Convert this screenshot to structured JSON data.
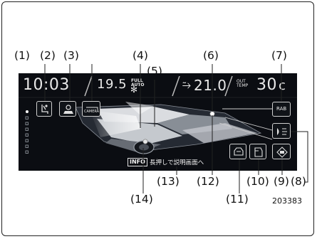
{
  "callouts": {
    "c1": "(1)",
    "c2": "(2)",
    "c3": "(3)",
    "c4": "(4)",
    "c5": "(5)",
    "c6": "(6)",
    "c7": "(7)",
    "c8": "(8)",
    "c9": "(9)",
    "c10": "(10)",
    "c11": "(11)",
    "c12": "(12)",
    "c13": "(13)",
    "c14": "(14)"
  },
  "figure_id": "203383",
  "screen": {
    "clock": "10:03",
    "temp_set": "19.5",
    "fan_mode": "FULL AUTO",
    "temp_right": "21.0",
    "out_temp_label": "OUT TEMP",
    "out_temp_value": "30",
    "out_temp_unit": "c",
    "btn_camera_label": "CAMERA",
    "btn_rab_label": "RAB",
    "info_tag": "INFO",
    "info_text": "長押しで説明画面へ"
  },
  "icons": {
    "btn1": "driver-seat-icon",
    "btn2": "vehicle-settings-icon",
    "btn3": "camera-icon",
    "btn7": "rab-icon",
    "btn8": "headlight-assist-icon",
    "btn9": "lane-assist-icon",
    "btn10": "door-icon",
    "btn11": "car-front-icon"
  }
}
